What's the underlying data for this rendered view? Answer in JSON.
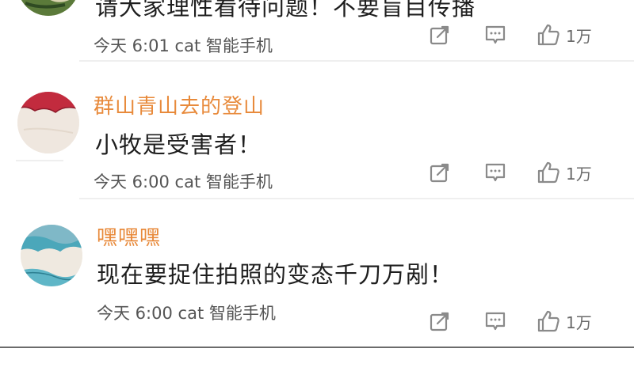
{
  "comments": [
    {
      "username": "",
      "text": "请大家理性看待问题！不要盲目传播",
      "time": "今天 6:01",
      "device": "cat 智能手机",
      "likes": "1万"
    },
    {
      "username": "群山青山去的登山",
      "text": "小牧是受害者！",
      "time": "今天 6:00",
      "device": "cat 智能手机",
      "likes": "1万"
    },
    {
      "username": "嘿嘿嘿",
      "text": "现在要捉住拍照的变态千刀万剐！",
      "time": "今天 6:00",
      "device": "cat 智能手机",
      "likes": "1万"
    }
  ],
  "icons": {
    "share": "share-icon",
    "reply": "comment-icon",
    "like": "thumbs-up-icon"
  },
  "colors": {
    "username": "#e88a3b",
    "icon": "#8a8a8a"
  }
}
